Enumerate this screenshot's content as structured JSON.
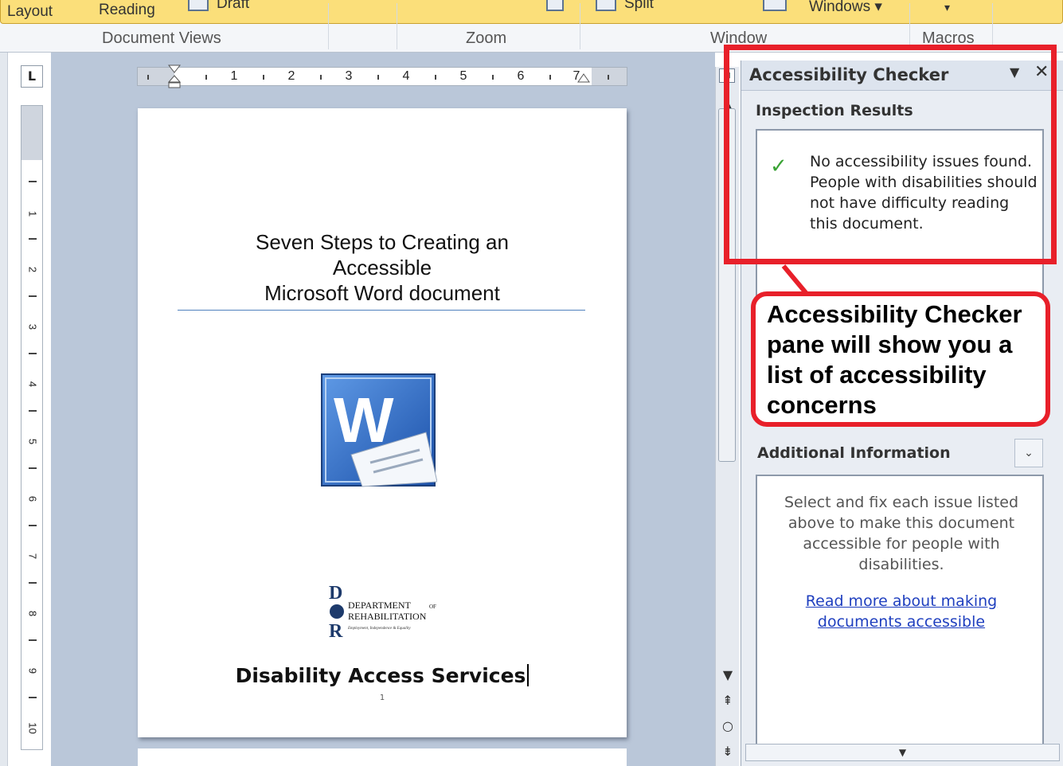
{
  "ribbon": {
    "view_buttons": [
      "Layout",
      "Reading",
      "Draft"
    ],
    "window_buttons": [
      "Split",
      "Windows ▾"
    ],
    "groups": [
      "Document Views",
      "Zoom",
      "Window",
      "Macros"
    ]
  },
  "rulers": {
    "horizontal_numbers": [
      "1",
      "2",
      "3",
      "4",
      "5",
      "6",
      "7"
    ],
    "vertical_numbers": [
      "1",
      "2",
      "3",
      "4",
      "5",
      "6",
      "7",
      "8",
      "9",
      "10"
    ]
  },
  "document": {
    "title_line1": "Seven Steps to Creating an",
    "title_line2": "Accessible",
    "title_line3": "Microsoft Word document",
    "word_logo_letter": "W",
    "dor_logo_line1": "DEPARTMENT",
    "dor_logo_of": "OF",
    "dor_logo_line2": "REHABILITATION",
    "dor_logo_tagline": "Employment, Independence & Equality",
    "footer_text": "Disability Access Services",
    "page_number": "1"
  },
  "pane": {
    "title": "Accessibility Checker",
    "dropdown_icon": "▼",
    "close_icon": "✕",
    "inspection_label": "Inspection Results",
    "check_icon": "✓",
    "result_message": "No accessibility issues found. People with disabilities should not have difficulty reading this document.",
    "additional_info_label": "Additional Information",
    "additional_info_toggle": "⌄",
    "additional_info_text": "Select and fix each issue listed above to make this document accessible for people with disabilities.",
    "link_text": "Read more about making documents accessible",
    "bottom_arrow": "▼"
  },
  "callout": {
    "text": "Accessibility Checker pane will show you a list of accessibility concerns",
    "color": "#e8202a"
  }
}
